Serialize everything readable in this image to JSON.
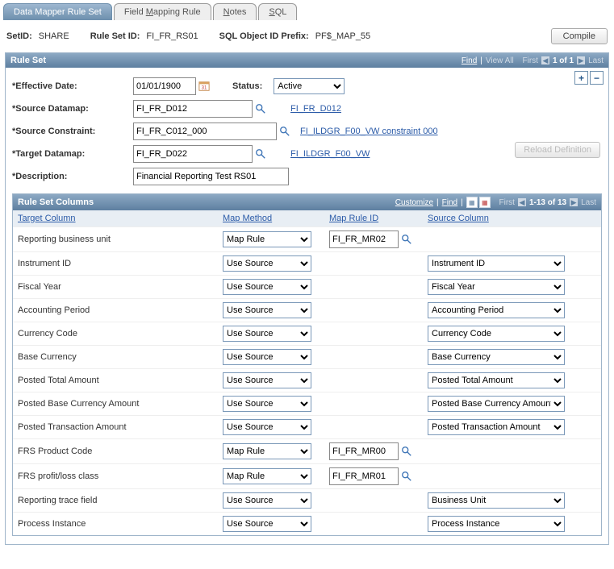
{
  "tabs": [
    {
      "label": "Data Mapper Rule Set",
      "active": true
    },
    {
      "label_pre": "Field ",
      "u": "M",
      "label_post": "apping Rule"
    },
    {
      "u": "N",
      "label_post": "otes"
    },
    {
      "u": "S",
      "label_post": "QL"
    }
  ],
  "header": {
    "setid_lbl": "SetID:",
    "setid": "SHARE",
    "ruleset_lbl": "Rule Set ID:",
    "ruleset": "FI_FR_RS01",
    "prefix_lbl": "SQL Object ID Prefix:",
    "prefix": "PF$_MAP_55",
    "compile": "Compile"
  },
  "rs": {
    "title": "Rule Set",
    "nav": {
      "find": "Find",
      "viewall": "View All",
      "first": "First",
      "pos": "1 of 1",
      "last": "Last"
    },
    "eff_lbl": "Effective Date:",
    "eff": "01/01/1900",
    "status_lbl": "Status:",
    "status": "Active",
    "src_lbl": "Source Datamap:",
    "src": "FI_FR_D012",
    "src_link": "FI_FR_D012",
    "con_lbl": "Source Constraint:",
    "con": "FI_FR_C012_000",
    "con_link": "FI_ILDGR_F00_VW constraint 000",
    "tgt_lbl": "Target Datamap:",
    "tgt": "FI_FR_D022",
    "tgt_link": "FI_ILDGR_F00_VW",
    "desc_lbl": "Description:",
    "desc": "Financial Reporting Test RS01",
    "reload": "Reload Definition"
  },
  "grid": {
    "title": "Rule Set Columns",
    "nav": {
      "customize": "Customize",
      "find": "Find",
      "first": "First",
      "pos": "1-13 of 13",
      "last": "Last"
    },
    "hdr": {
      "target": "Target Column",
      "method": "Map Method",
      "rule": "Map Rule ID",
      "source": "Source Column"
    },
    "rows": [
      {
        "target": "Reporting business unit",
        "method": "Map Rule",
        "rule": "FI_FR_MR02",
        "source": ""
      },
      {
        "target": "Instrument ID",
        "method": "Use Source",
        "rule": "",
        "source": "Instrument ID"
      },
      {
        "target": "Fiscal Year",
        "method": "Use Source",
        "rule": "",
        "source": "Fiscal Year"
      },
      {
        "target": "Accounting Period",
        "method": "Use Source",
        "rule": "",
        "source": "Accounting Period"
      },
      {
        "target": "Currency Code",
        "method": "Use Source",
        "rule": "",
        "source": "Currency Code"
      },
      {
        "target": "Base Currency",
        "method": "Use Source",
        "rule": "",
        "source": "Base Currency"
      },
      {
        "target": "Posted Total Amount",
        "method": "Use Source",
        "rule": "",
        "source": "Posted Total Amount"
      },
      {
        "target": "Posted Base Currency Amount",
        "method": "Use Source",
        "rule": "",
        "source": "Posted Base Currency Amount"
      },
      {
        "target": "Posted Transaction Amount",
        "method": "Use Source",
        "rule": "",
        "source": "Posted Transaction Amount"
      },
      {
        "target": "FRS Product Code",
        "method": "Map Rule",
        "rule": "FI_FR_MR00",
        "source": ""
      },
      {
        "target": "FRS profit/loss class",
        "method": "Map Rule",
        "rule": "FI_FR_MR01",
        "source": ""
      },
      {
        "target": "Reporting trace field",
        "method": "Use Source",
        "rule": "",
        "source": "Business Unit"
      },
      {
        "target": "Process Instance",
        "method": "Use Source",
        "rule": "",
        "source": "Process Instance"
      }
    ]
  }
}
